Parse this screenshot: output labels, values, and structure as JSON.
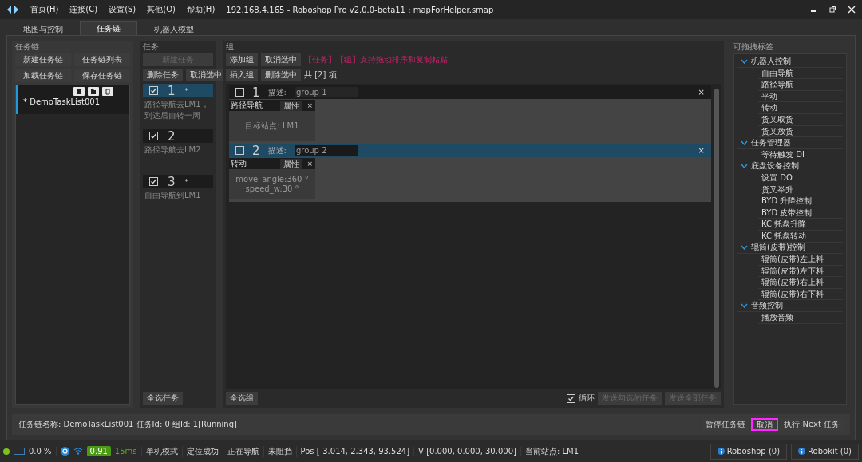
{
  "window": {
    "title": "192.168.4.165 - Roboshop Pro v2.0.0-beta11 : mapForHelper.smap"
  },
  "menu": [
    "首页(H)",
    "连接(C)",
    "设置(S)",
    "其他(O)",
    "帮助(H)"
  ],
  "tabs": [
    {
      "label": "地图与控制",
      "selected": false
    },
    {
      "label": "任务链",
      "selected": true
    },
    {
      "label": "机器人模型",
      "selected": false
    }
  ],
  "chain_panel": {
    "title": "任务链",
    "buttons": [
      {
        "label": "新建任务链",
        "disabled": false
      },
      {
        "label": "任务链列表",
        "disabled": false
      },
      {
        "label": "加载任务链",
        "disabled": false
      },
      {
        "label": "保存任务链",
        "disabled": false
      }
    ],
    "items": [
      {
        "name": "* DemoTaskList001",
        "selected": true
      }
    ]
  },
  "task_panel": {
    "title": "任务",
    "new_button": {
      "label": "新建任务",
      "disabled": true
    },
    "buttons": [
      {
        "label": "删除任务",
        "disabled": false
      },
      {
        "label": "取消选中",
        "disabled": false
      }
    ],
    "tasks": [
      {
        "number": "1",
        "mark": "*",
        "checked": true,
        "selected": true,
        "description": "路径导航去LM1，到达后自转一周"
      },
      {
        "number": "2",
        "checked": true,
        "selected": false,
        "description": "路径导航去LM2"
      },
      {
        "number": "3",
        "mark": "*",
        "checked": true,
        "selected": false,
        "description": "自由导航到LM1"
      }
    ],
    "select_all": "全选任务"
  },
  "group_panel": {
    "title": "组",
    "buttons_row1": [
      {
        "label": "添加组",
        "disabled": false
      },
      {
        "label": "取消选中",
        "disabled": false
      }
    ],
    "hint": "【任务】【组】支持拖动排序和复制粘贴",
    "buttons_row2": [
      {
        "label": "插入组",
        "disabled": false
      },
      {
        "label": "删除选中",
        "disabled": false
      }
    ],
    "count": "共 [2] 项",
    "groups": [
      {
        "number": "1",
        "checked": false,
        "selected": false,
        "desc_label": "描述:",
        "desc_value": "group 1",
        "close": "×",
        "actions": [
          {
            "name": "路径导航",
            "button": "属性",
            "close": "×",
            "params": [
              "目标站点:  LM1"
            ]
          }
        ]
      },
      {
        "number": "2",
        "checked": false,
        "selected": true,
        "desc_label": "描述:",
        "desc_value": "group 2",
        "close": "×",
        "actions": [
          {
            "name": "转动",
            "button": "属性",
            "close": "×",
            "params": [
              "move_angle:360 °",
              "speed_w:30 °"
            ]
          }
        ]
      }
    ],
    "select_all": "全选组",
    "loop": {
      "label": "循环",
      "checked": true
    },
    "send_buttons": [
      {
        "label": "发送勾选的任务",
        "disabled": true
      },
      {
        "label": "发送全部任务",
        "disabled": true
      }
    ]
  },
  "tag_panel": {
    "title": "可拖拽标签",
    "tree": [
      {
        "label": "机器人控制",
        "expanded": true,
        "children": [
          {
            "label": "自由导航"
          },
          {
            "label": "路径导航"
          },
          {
            "label": "平动"
          },
          {
            "label": "转动"
          },
          {
            "label": "货叉取货"
          },
          {
            "label": "货叉放货"
          }
        ]
      },
      {
        "label": "任务管理器",
        "expanded": true,
        "children": [
          {
            "label": "等待触发 DI"
          }
        ]
      },
      {
        "label": "底盘设备控制",
        "expanded": true,
        "children": [
          {
            "label": "设置 DO"
          },
          {
            "label": "货叉举升"
          },
          {
            "label": "BYD 升降控制"
          },
          {
            "label": "BYD 皮带控制"
          },
          {
            "label": "KC 托盘升降"
          },
          {
            "label": "KC 托盘转动"
          }
        ]
      },
      {
        "label": "辊筒(皮带)控制",
        "expanded": true,
        "children": [
          {
            "label": "辊筒(皮带)左上料"
          },
          {
            "label": "辊筒(皮带)左下料"
          },
          {
            "label": "辊筒(皮带)右上料"
          },
          {
            "label": "辊筒(皮带)右下料"
          }
        ]
      },
      {
        "label": "音频控制",
        "expanded": true,
        "children": [
          {
            "label": "播放音频"
          }
        ]
      }
    ]
  },
  "info_bar": {
    "text": "任务链名称:  DemoTaskList001 任务Id: 0 组Id: 1[Running]",
    "buttons": [
      {
        "label": "暂停任务链",
        "outlined": false
      },
      {
        "label": "取消",
        "outlined": true
      },
      {
        "label": "执行 Next 任务",
        "outlined": false
      }
    ]
  },
  "status_bar": {
    "battery": "0.0 %",
    "confidence": "0.91",
    "latency": "15ms",
    "fields": [
      "单机模式",
      "定位成功",
      "正在导航",
      "未阻挡",
      "Pos [-3.014, 2.343, 93.524]",
      "V [0.000, 0.000, 30.000]"
    ],
    "station": "当前站点:  LM1",
    "apps": [
      "Roboshop (0)",
      "Robokit (0)"
    ]
  }
}
